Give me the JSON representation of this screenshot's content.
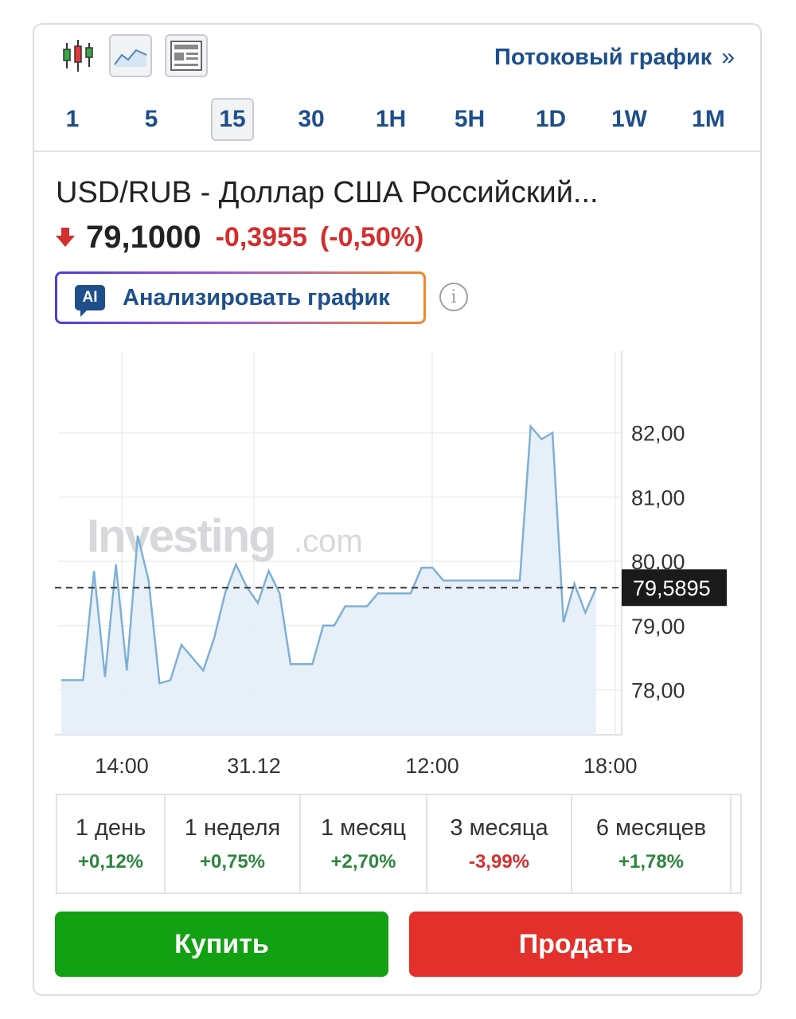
{
  "toolbar": {
    "tools": [
      {
        "name": "candles-icon",
        "active": false
      },
      {
        "name": "area-line-icon",
        "active": true
      },
      {
        "name": "news-list-icon",
        "active": false
      }
    ],
    "stream_link": "Потоковый график",
    "stream_chevron": "»"
  },
  "intervals": [
    {
      "label": "1",
      "active": false
    },
    {
      "label": "5",
      "active": false
    },
    {
      "label": "15",
      "active": true
    },
    {
      "label": "30",
      "active": false
    },
    {
      "label": "1H",
      "active": false
    },
    {
      "label": "5H",
      "active": false
    },
    {
      "label": "1D",
      "active": false
    },
    {
      "label": "1W",
      "active": false
    },
    {
      "label": "1M",
      "active": false
    }
  ],
  "instrument": {
    "title": "USD/RUB - Доллар США Российский...",
    "price": "79,1000",
    "change": "-0,3955",
    "change_pct": "(-0,50%)",
    "direction": "down"
  },
  "ai": {
    "badge": "AI",
    "label": "Анализировать график"
  },
  "chart_data": {
    "type": "area",
    "x_tick_labels": [
      "14:00",
      "31.12",
      "12:00",
      "18:00"
    ],
    "y_tick_labels": [
      "82,00",
      "81,00",
      "80,00",
      "79,00",
      "78,00"
    ],
    "ylim": [
      77.3,
      82.9
    ],
    "current_value": "79,5895",
    "current_value_num": 79.5895,
    "watermark_brand": "Investing",
    "watermark_suffix": ".com",
    "grid": true,
    "line_color": "#7fb0d6",
    "fill_color": "#e4eef7",
    "series": [
      {
        "values": [
          78.15,
          78.15,
          78.15,
          79.85,
          78.2,
          79.95,
          78.3,
          80.4,
          79.7,
          78.1,
          78.15,
          78.7,
          78.5,
          78.3,
          78.8,
          79.5,
          79.95,
          79.6,
          79.35,
          79.85,
          79.5,
          78.4,
          78.4,
          78.4,
          79.0,
          79.0,
          79.3,
          79.3,
          79.3,
          79.5,
          79.5,
          79.5,
          79.5,
          79.9,
          79.9,
          79.7,
          79.7,
          79.7,
          79.7,
          79.7,
          79.7,
          79.7,
          79.7,
          82.1,
          81.9,
          82.0,
          79.05,
          79.65,
          79.2,
          79.59
        ]
      }
    ]
  },
  "periods": [
    {
      "name": "1 день",
      "value": "+0,12%",
      "sign": "pos"
    },
    {
      "name": "1 неделя",
      "value": "+0,75%",
      "sign": "pos"
    },
    {
      "name": "1 месяц",
      "value": "+2,70%",
      "sign": "pos"
    },
    {
      "name": "3 месяца",
      "value": "-3,99%",
      "sign": "neg"
    },
    {
      "name": "6 месяцев",
      "value": "+1,78%",
      "sign": "pos"
    }
  ],
  "actions": {
    "buy": "Купить",
    "sell": "Продать"
  }
}
